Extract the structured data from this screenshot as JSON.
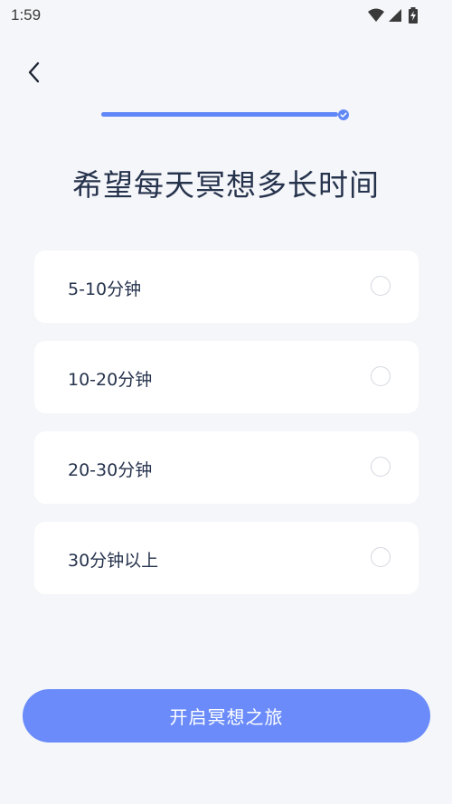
{
  "status_bar": {
    "time": "1:59",
    "icons": [
      "wifi-icon",
      "signal-icon",
      "battery-charging-icon"
    ]
  },
  "navigation": {
    "back_icon": "chevron-left-icon"
  },
  "progress": {
    "completed_fraction": 1.0,
    "end_icon": "check-circle-icon",
    "color": "#5f87f7"
  },
  "page": {
    "title": "希望每天冥想多长时间"
  },
  "options": [
    {
      "label": "5-10分钟",
      "selected": false
    },
    {
      "label": "10-20分钟",
      "selected": false
    },
    {
      "label": "20-30分钟",
      "selected": false
    },
    {
      "label": "30分钟以上",
      "selected": false
    }
  ],
  "actions": {
    "start_label": "开启冥想之旅"
  },
  "colors": {
    "background": "#f5f6f9",
    "card": "#ffffff",
    "primary": "#6a8bf9",
    "title_text": "#26334d"
  }
}
